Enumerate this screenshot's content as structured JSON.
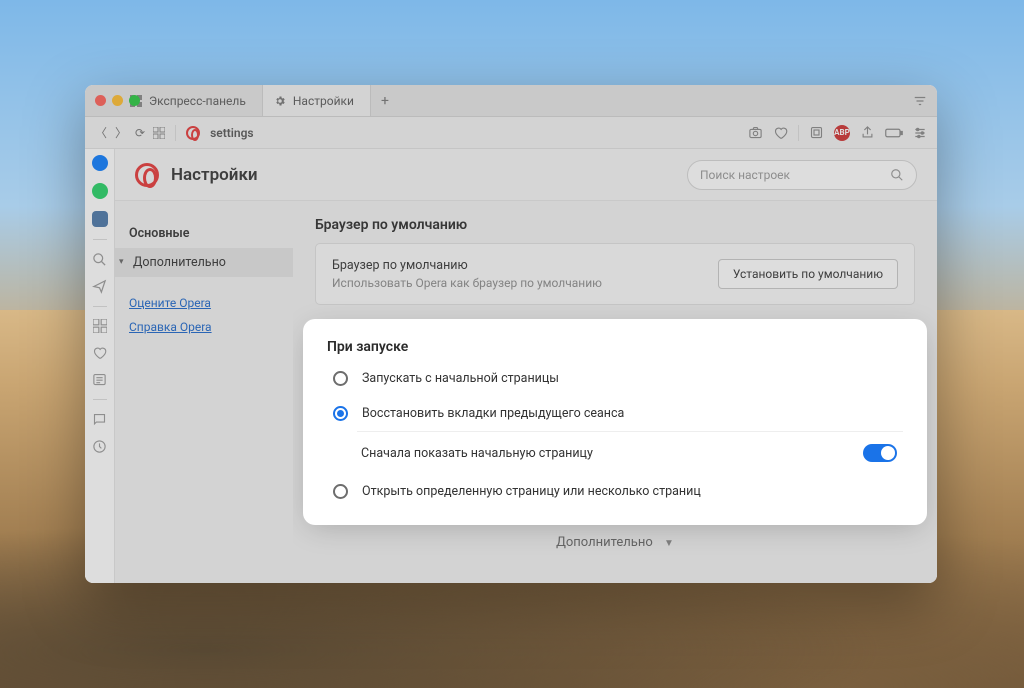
{
  "tabs": [
    {
      "label": "Экспресс-панель",
      "active": false
    },
    {
      "label": "Настройки",
      "active": true
    }
  ],
  "address": "settings",
  "header": {
    "title": "Настройки"
  },
  "search": {
    "placeholder": "Поиск настроек"
  },
  "sidebar": {
    "items": [
      {
        "label": "Основные",
        "kind": "bold"
      },
      {
        "label": "Дополнительно",
        "kind": "selected"
      }
    ],
    "links": [
      {
        "label": "Оцените Opera"
      },
      {
        "label": "Справка Opera"
      }
    ]
  },
  "default_browser": {
    "section_title": "Браузер по умолчанию",
    "title": "Браузер по умолчанию",
    "subtitle": "Использовать Opera как браузер по умолчанию",
    "button": "Установить по умолчанию"
  },
  "startup": {
    "section_title": "При запуске",
    "options": [
      {
        "label": "Запускать с начальной страницы",
        "selected": false
      },
      {
        "label": "Восстановить вкладки предыдущего сеанса",
        "selected": true
      },
      {
        "label": "Открыть определенную страницу или несколько страниц",
        "selected": false
      }
    ],
    "sub_option": {
      "label": "Сначала показать начальную страницу",
      "enabled": true
    }
  },
  "more_label": "Дополнительно",
  "toolbar_icons": {
    "abp": "ABP"
  }
}
